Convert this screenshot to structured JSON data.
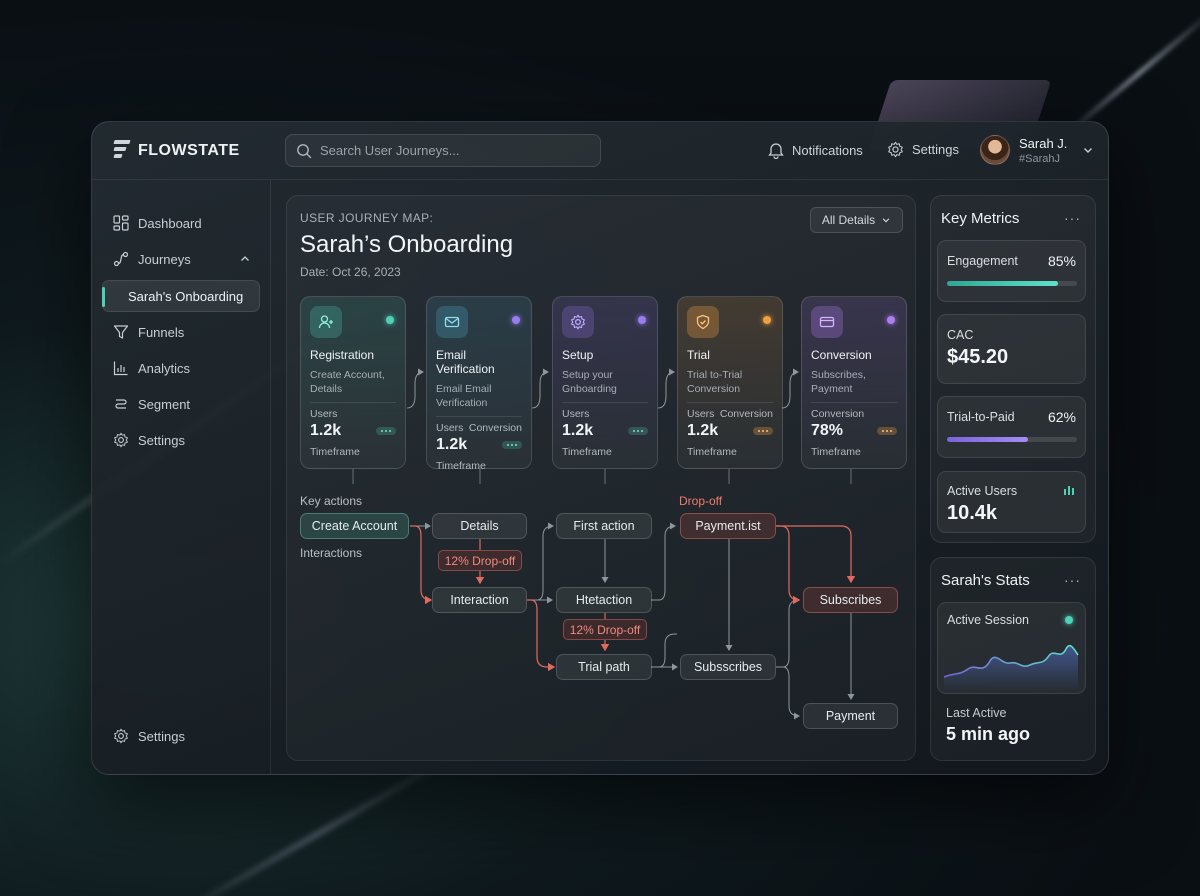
{
  "app": {
    "logo_text": "FLOWSTATE"
  },
  "search": {
    "placeholder": "Search User Journeys..."
  },
  "topbar": {
    "notifications_label": "Notifications",
    "settings_label": "Settings"
  },
  "user": {
    "name": "Sarah J.",
    "handle": "#SarahJ"
  },
  "sidebar": {
    "items": [
      {
        "label": "Dashboard",
        "icon": "grid-icon"
      },
      {
        "label": "Journeys",
        "icon": "route-icon"
      },
      {
        "label": "Sarah's Onboarding",
        "active": true
      },
      {
        "label": "Funnels",
        "icon": "funnel-icon"
      },
      {
        "label": "Analytics",
        "icon": "bar-chart-icon"
      },
      {
        "label": "Segment",
        "icon": "segment-icon"
      },
      {
        "label": "Settings",
        "icon": "gear-icon"
      }
    ],
    "footer_settings_label": "Settings"
  },
  "journey": {
    "label": "USER JOURNEY MAP:",
    "title": "Sarah’s Onboarding",
    "date": "Date: Oct 26, 2023",
    "filter_label": "All Details",
    "stages": [
      {
        "title": "Registration",
        "subtitle": "Create Account, Details",
        "metric_a": "Users",
        "metric_b": "",
        "value": "1.2k",
        "timeframe": "Timeframe",
        "accent": "#4fd1b8",
        "icon": "user-plus-icon"
      },
      {
        "title": "Email Verification",
        "subtitle": "Email Email Verification",
        "metric_a": "Users",
        "metric_b": "Conversion",
        "value": "1.2k",
        "timeframe": "Timeframe",
        "accent": "#9b7cf0",
        "icon": "mail-icon"
      },
      {
        "title": "Setup",
        "subtitle": "Setup your Gnboarding",
        "metric_a": "Users",
        "metric_b": "",
        "value": "1.2k",
        "timeframe": "Timeframe",
        "accent": "#9b7cf0",
        "icon": "gear-icon"
      },
      {
        "title": "Trial",
        "subtitle": "Trial to-Trial Conversion",
        "metric_a": "Users",
        "metric_b": "Conversion",
        "value": "1.2k",
        "timeframe": "Timeframe",
        "accent": "#f0a043",
        "icon": "shield-icon"
      },
      {
        "title": "Conversion",
        "subtitle": "Subscribes, Payment",
        "metric_a": "Conversion",
        "metric_b": "",
        "value": "78%",
        "timeframe": "Timeframe",
        "accent": "#b07cf0",
        "icon": "card-icon"
      }
    ],
    "flow": {
      "key_actions_label": "Key actions",
      "interactions_label": "Interactions",
      "dropoff_label": "Drop-off",
      "nodes": {
        "create_account": "Create Account",
        "details": "Details",
        "first_action": "First action",
        "payment_ist": "Payment.ist",
        "interaction": "Interaction",
        "htetaction": "Htetaction",
        "subscribes": "Subscribes",
        "trial_path": "Trial path",
        "subsscribes": "Subsscribes",
        "payment": "Payment"
      },
      "drop1": "12% Drop-off",
      "drop2": "12% Drop-off"
    }
  },
  "key_metrics": {
    "title": "Key Metrics",
    "more": "···",
    "engagement": {
      "label": "Engagement",
      "value": "85%",
      "fill": 0.85
    },
    "cac": {
      "label": "CAC",
      "value": "$45.20"
    },
    "trial_to_paid": {
      "label": "Trial-to-Paid",
      "value": "62%",
      "fill": 0.62
    },
    "active_users": {
      "label": "Active Users",
      "value": "10.4k"
    }
  },
  "stats": {
    "title": "Sarah's Stats",
    "more": "···",
    "active_session_label": "Active Session",
    "last_active_label": "Last Active",
    "last_active_value": "5 min ago"
  }
}
